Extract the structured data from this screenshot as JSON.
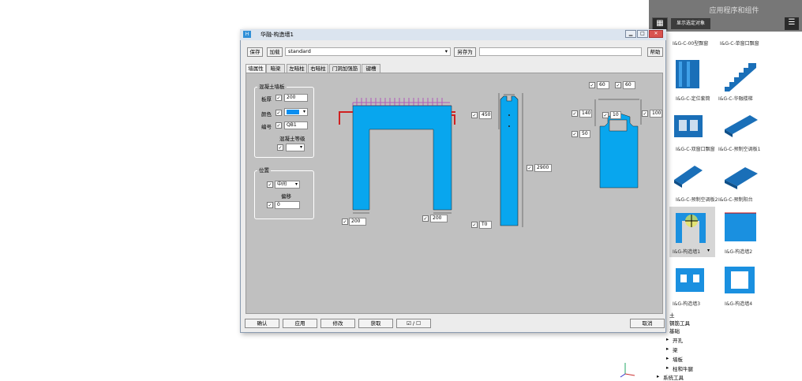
{
  "right_panel": {
    "title": "应用程序和组件",
    "selected_label": "显示选定对象",
    "items": [
      {
        "label": "I&G-C-00型飘窗"
      },
      {
        "label": "I&G-C-单窗口飘窗"
      },
      {
        "label": "I&G-C-定位套筒"
      },
      {
        "label": "I&G-C-华融楼梯"
      },
      {
        "label": "I&G-C-双窗口飘窗"
      },
      {
        "label": "I&G-C-预制空调板1"
      },
      {
        "label": "I&G-C-预制空调板2"
      },
      {
        "label": "I&G-C-预制阳台"
      },
      {
        "label": "I&G-构造墙1"
      },
      {
        "label": "I&G-构造墙2"
      },
      {
        "label": "I&G-构造墙3"
      },
      {
        "label": "I&G-构造墙4"
      }
    ],
    "tree": [
      "土",
      "钢筋工具",
      "基础",
      "开孔",
      "梁",
      "墙板",
      "柱和牛腿",
      "系统工具"
    ]
  },
  "dialog": {
    "title": "华融-构造墙1",
    "save": "保存",
    "load": "加载",
    "preset": "standard",
    "save_as": "另存为",
    "help": "帮助",
    "tabs": [
      "墙属性",
      "暗梁",
      "左暗柱",
      "右暗柱",
      "门洞加强筋",
      "键槽"
    ],
    "group_concrete": "混凝土墙板",
    "thickness_label": "板厚",
    "thickness": "200",
    "color_label": "颜色",
    "number_label": "编号",
    "number": "QB1",
    "grade_label": "混凝土等级",
    "group_position": "位置",
    "position": "中间",
    "offset_label": "偏移",
    "offset": "0",
    "dims": {
      "left_leg": "200",
      "right_leg": "200",
      "top_height": "450",
      "total_height": "2900",
      "bottom": "T0",
      "key_left": "60",
      "key_right": "60",
      "key_140": "140",
      "key_10": "10",
      "key_100": "100",
      "key_50": "50"
    },
    "footer": {
      "ok": "确认",
      "apply": "应用",
      "modify": "修改",
      "get": "获取",
      "toggle": "☑ / ☐",
      "cancel": "取消"
    }
  }
}
